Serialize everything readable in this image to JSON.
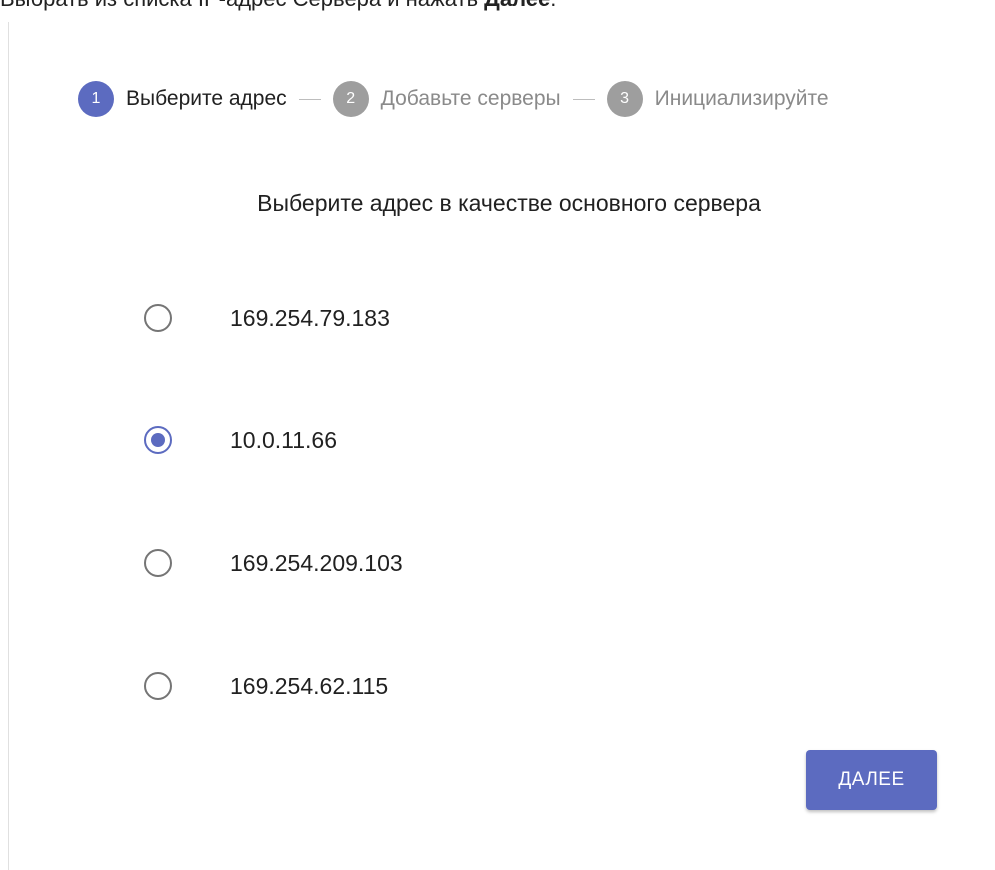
{
  "instruction": {
    "text": "Выбрать из списка IP-адрес Сервера и нажать ",
    "bold": "Далее",
    "end": "."
  },
  "stepper": {
    "steps": [
      {
        "number": "1",
        "label": "Выберите адрес",
        "active": true
      },
      {
        "number": "2",
        "label": "Добавьте серверы",
        "active": false
      },
      {
        "number": "3",
        "label": "Инициализируйте",
        "active": false
      }
    ]
  },
  "main": {
    "heading": "Выберите адрес в качестве основного сервера",
    "addresses": [
      {
        "label": "169.254.79.183",
        "selected": false
      },
      {
        "label": "10.0.11.66",
        "selected": true
      },
      {
        "label": "169.254.209.103",
        "selected": false
      },
      {
        "label": "169.254.62.115",
        "selected": false
      }
    ]
  },
  "actions": {
    "next_label": "ДАЛЕЕ"
  },
  "colors": {
    "accent": "#5c6bc0",
    "inactive_step": "#9e9e9e"
  }
}
